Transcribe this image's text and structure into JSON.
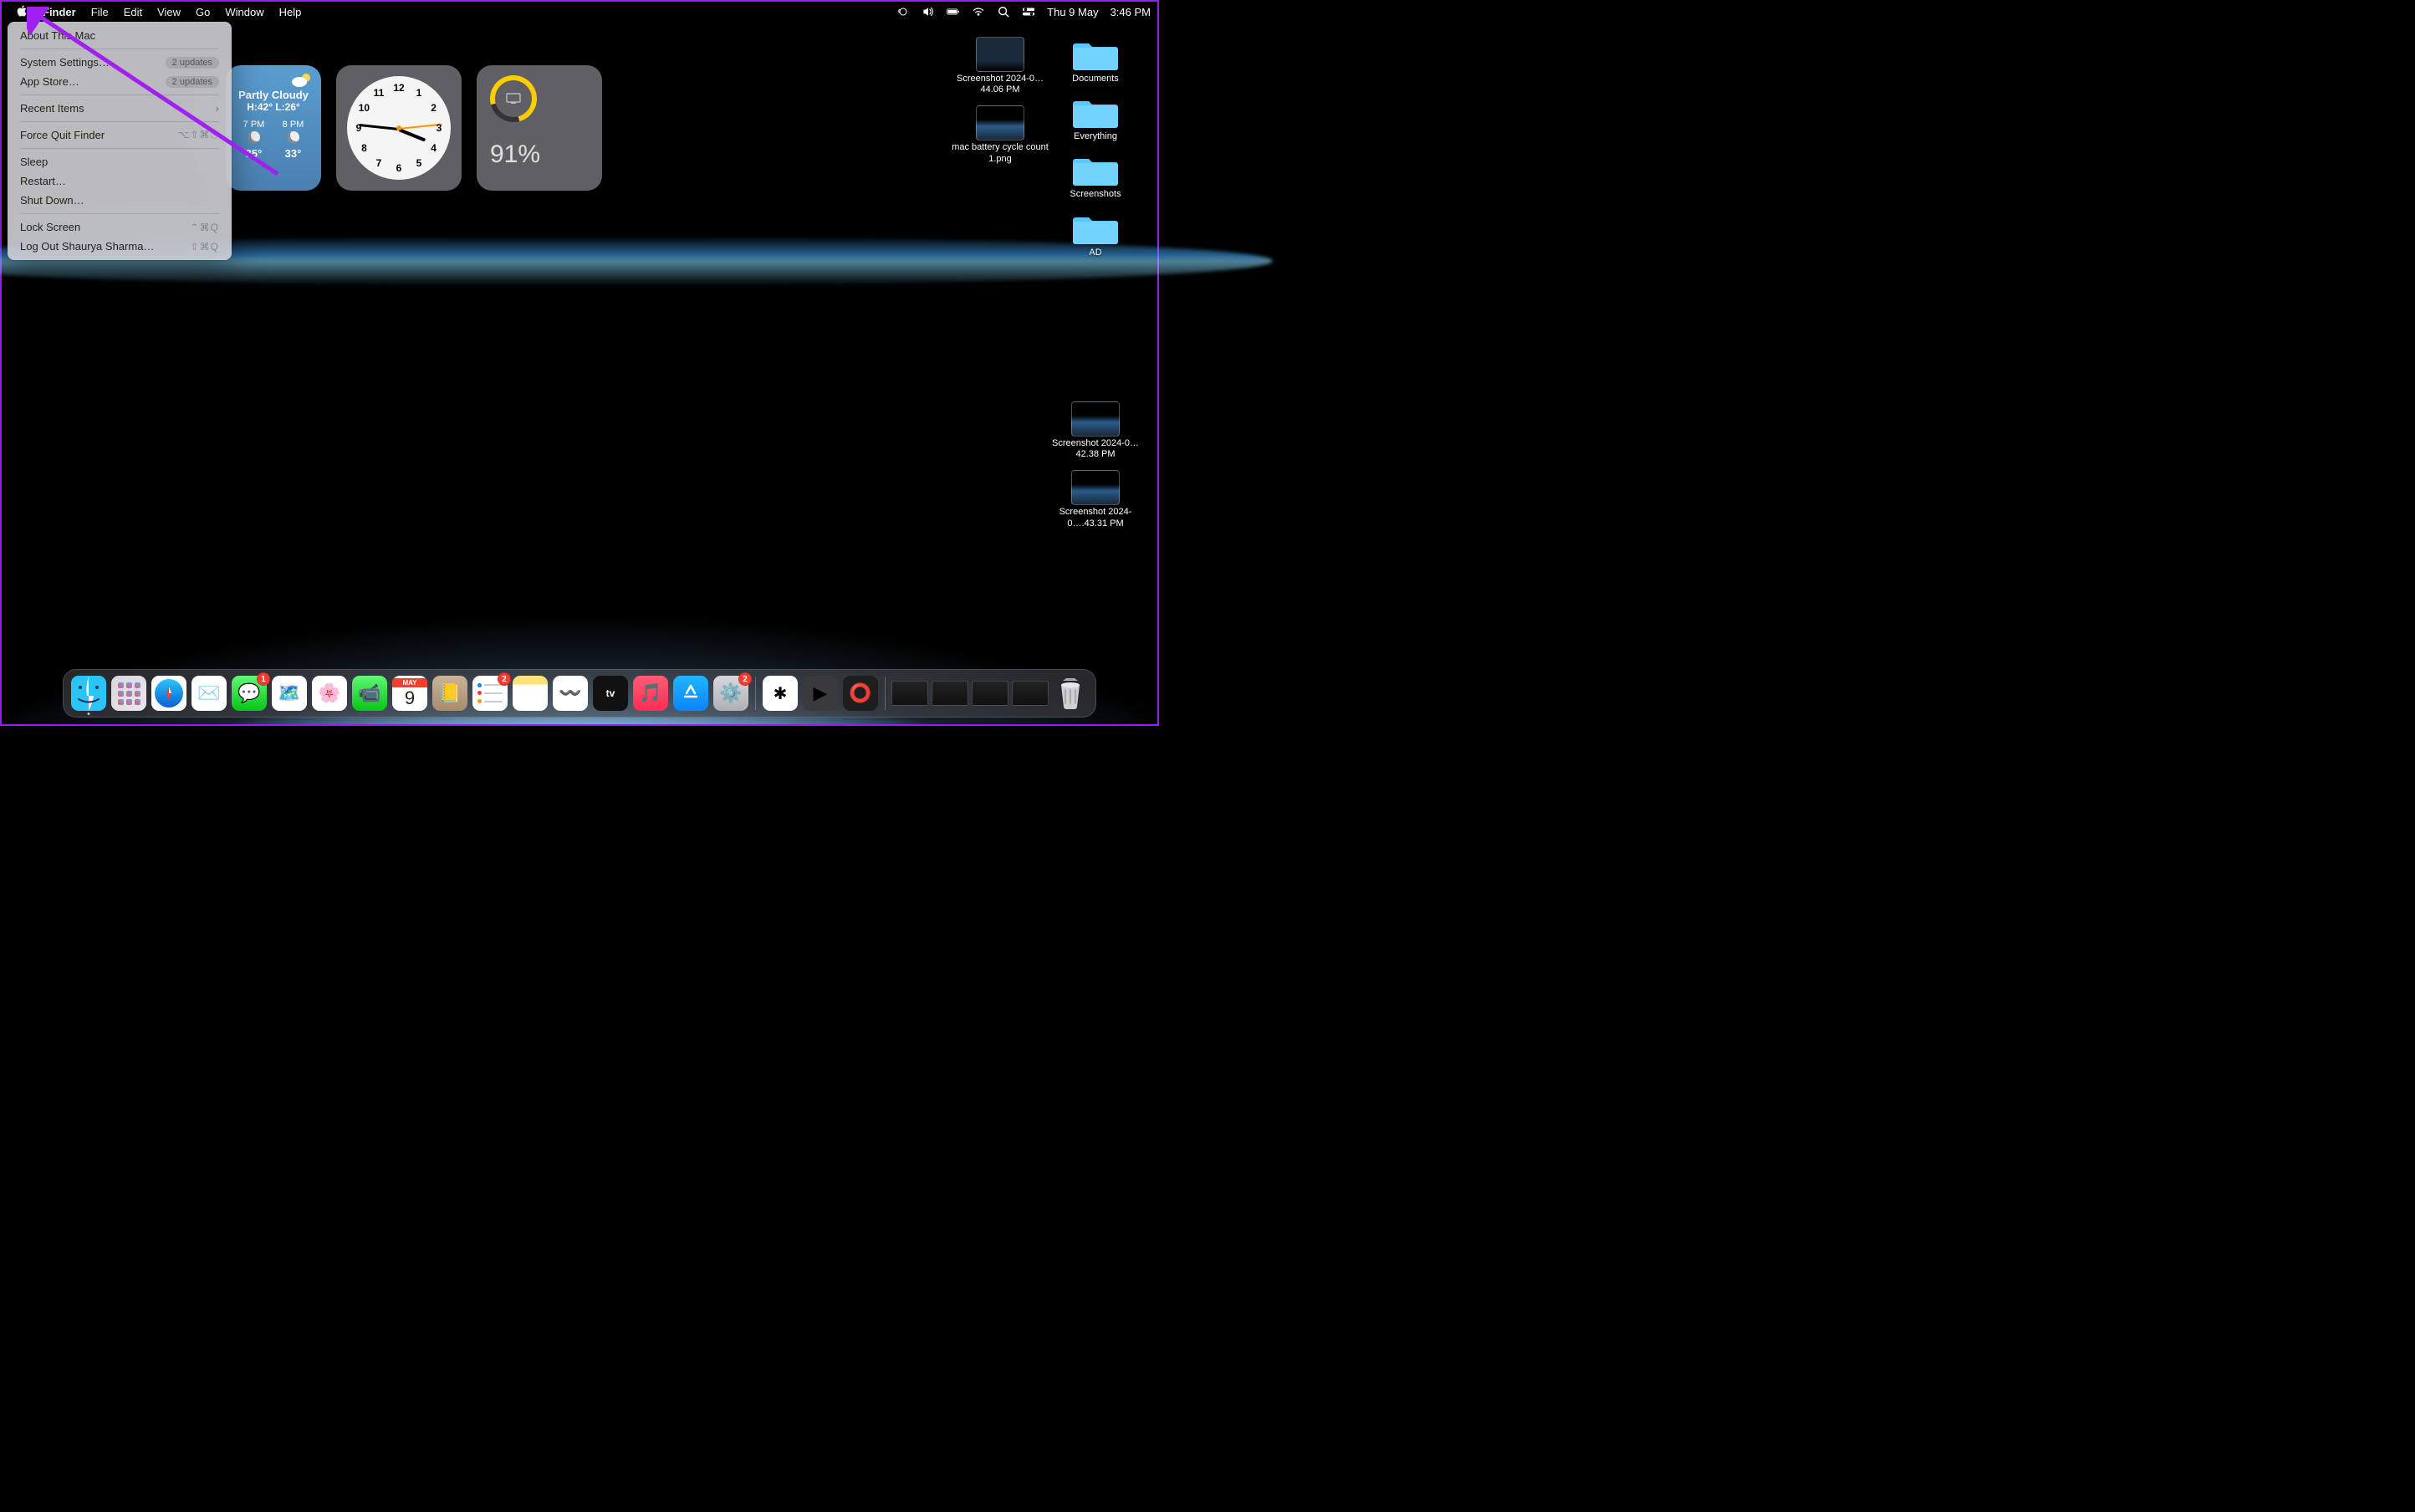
{
  "menubar": {
    "app": "Finder",
    "items": [
      "File",
      "Edit",
      "View",
      "Go",
      "Window",
      "Help"
    ],
    "date": "Thu 9 May",
    "time": "3:46 PM"
  },
  "apple_menu": {
    "items": [
      {
        "label": "About This Mac"
      },
      {
        "divider": true
      },
      {
        "label": "System Settings…",
        "badge": "2 updates"
      },
      {
        "label": "App Store…",
        "badge": "2 updates"
      },
      {
        "divider": true
      },
      {
        "label": "Recent Items",
        "submenu": true
      },
      {
        "divider": true
      },
      {
        "label": "Force Quit Finder",
        "shortcut": "⌥⇧⌘⎋"
      },
      {
        "divider": true
      },
      {
        "label": "Sleep"
      },
      {
        "label": "Restart…"
      },
      {
        "label": "Shut Down…"
      },
      {
        "divider": true
      },
      {
        "label": "Lock Screen",
        "shortcut": "⌃⌘Q"
      },
      {
        "label": "Log Out Shaurya Sharma…",
        "shortcut": "⇧⌘Q"
      }
    ]
  },
  "widgets": {
    "weather": {
      "condition": "Partly Cloudy",
      "high_low": "H:42° L:26°",
      "hours": [
        {
          "time": "7 PM",
          "temp": "35°"
        },
        {
          "time": "8 PM",
          "temp": "33°"
        }
      ]
    },
    "battery": {
      "percent": "91%"
    }
  },
  "desktop": {
    "col1": [
      {
        "type": "img",
        "name": "Screenshot 2024-0…44.06 PM",
        "thumb": "twin"
      },
      {
        "type": "img",
        "name": "mac battery cycle count 1.png",
        "thumb": "tearth"
      }
    ],
    "col1b": [
      {
        "type": "img",
        "name": "Screenshot 2024-0…42.38 PM",
        "thumb": "tearth"
      },
      {
        "type": "img",
        "name": "Screenshot 2024-0….43.31 PM",
        "thumb": "tearth"
      }
    ],
    "col2": [
      {
        "type": "folder",
        "name": "Documents"
      },
      {
        "type": "folder",
        "name": "Everything"
      },
      {
        "type": "folder",
        "name": "Screenshots"
      },
      {
        "type": "folder",
        "name": "AD"
      }
    ]
  },
  "dock": {
    "apps": [
      {
        "name": "finder",
        "fill": "linear-gradient(180deg,#29c5f6,#0a84d8)",
        "glyph": "😀",
        "running": true
      },
      {
        "name": "launchpad",
        "fill": "linear-gradient(135deg,#d8d8dc,#e8e8ec)",
        "glyph": ""
      },
      {
        "name": "safari",
        "fill": "#fff",
        "glyph": "🧭"
      },
      {
        "name": "mail",
        "fill": "#fff",
        "glyph": "✉️"
      },
      {
        "name": "messages",
        "fill": "linear-gradient(180deg,#5ff777,#06c614)",
        "glyph": "💬",
        "badge": "1"
      },
      {
        "name": "maps",
        "fill": "#fff",
        "glyph": "🗺️"
      },
      {
        "name": "photos",
        "fill": "#fff",
        "glyph": "🌸"
      },
      {
        "name": "facetime",
        "fill": "linear-gradient(180deg,#5ff777,#06c614)",
        "glyph": "📹"
      },
      {
        "name": "calendar",
        "fill": "#fff",
        "glyph": "",
        "badge": ""
      },
      {
        "name": "contacts",
        "fill": "linear-gradient(180deg,#c9b49a,#a98c6a)",
        "glyph": "📒"
      },
      {
        "name": "reminders",
        "fill": "#fff",
        "glyph": "",
        "badge": "2"
      },
      {
        "name": "notes",
        "fill": "linear-gradient(180deg,#ffe27a 25%,#fff 25%)",
        "glyph": ""
      },
      {
        "name": "freeform",
        "fill": "#fff",
        "glyph": "〰️"
      },
      {
        "name": "tv",
        "fill": "#111",
        "glyph": "tv"
      },
      {
        "name": "music",
        "fill": "linear-gradient(180deg,#ff5c74,#ff2d55)",
        "glyph": "🎵"
      },
      {
        "name": "appstore",
        "fill": "linear-gradient(180deg,#1fb6ff,#0a84ff)",
        "glyph": "A"
      },
      {
        "name": "settings",
        "fill": "linear-gradient(180deg,#d8d8dc,#b0b0b6)",
        "glyph": "⚙️",
        "badge": "2"
      }
    ],
    "extras": [
      {
        "name": "slack",
        "fill": "#fff",
        "glyph": ""
      },
      {
        "name": "quicktime",
        "fill": "#3a3a3c",
        "glyph": "▶"
      },
      {
        "name": "opera",
        "fill": "#1e1e1e",
        "glyph": "⭕"
      }
    ],
    "calendar": {
      "month": "MAY",
      "day": "9"
    }
  }
}
